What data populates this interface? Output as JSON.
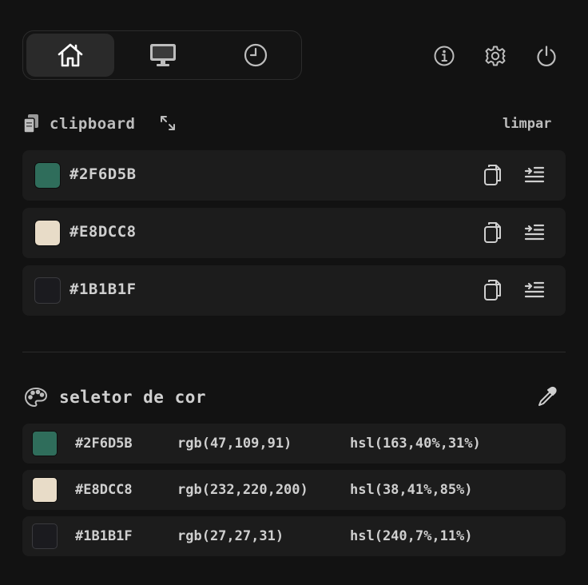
{
  "nav": {
    "tabs": [
      {
        "icon": "home-icon",
        "active": true
      },
      {
        "icon": "monitor-icon",
        "active": false
      },
      {
        "icon": "clock-icon",
        "active": false
      }
    ],
    "actions": [
      "info-icon",
      "gear-icon",
      "power-icon"
    ]
  },
  "clipboard": {
    "title": "clipboard",
    "clear_label": "limpar",
    "items": [
      {
        "hex": "#2F6D5B",
        "color": "#2F6D5B"
      },
      {
        "hex": "#E8DCC8",
        "color": "#E8DCC8"
      },
      {
        "hex": "#1B1B1F",
        "color": "#1B1B1F"
      }
    ]
  },
  "picker": {
    "title": "seletor de cor",
    "rows": [
      {
        "hex": "#2F6D5B",
        "rgb": "rgb(47,109,91)",
        "hsl": "hsl(163,40%,31%)",
        "color": "#2F6D5B"
      },
      {
        "hex": "#E8DCC8",
        "rgb": "rgb(232,220,200)",
        "hsl": "hsl(38,41%,85%)",
        "color": "#E8DCC8"
      },
      {
        "hex": "#1B1B1F",
        "rgb": "rgb(27,27,31)",
        "hsl": "hsl(240,7%,11%)",
        "color": "#1B1B1F"
      }
    ]
  }
}
